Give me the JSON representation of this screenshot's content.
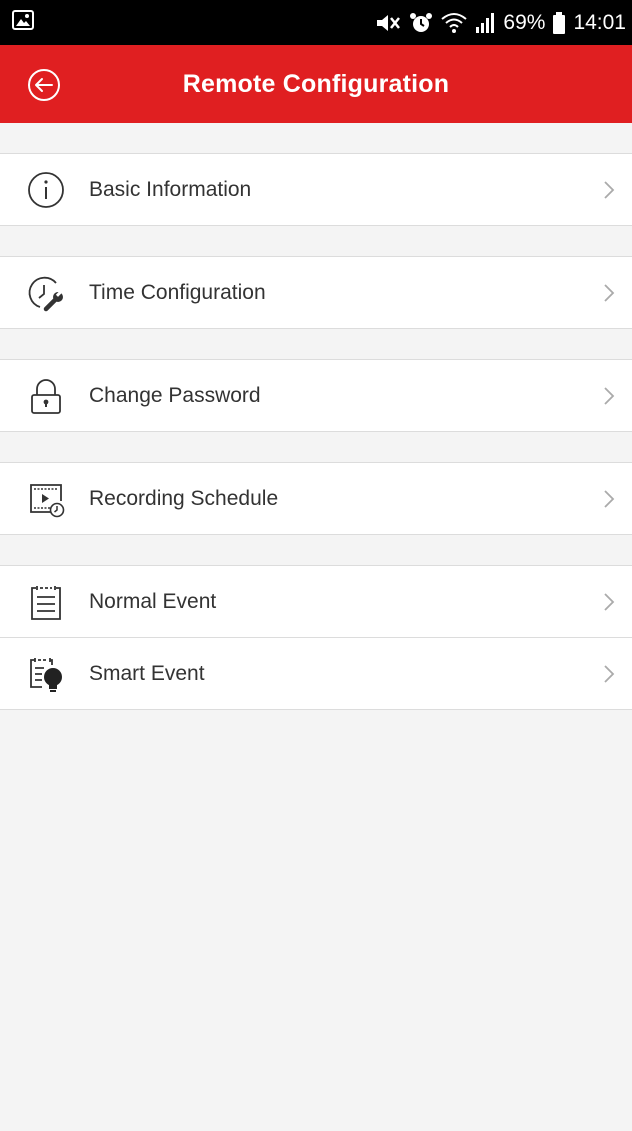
{
  "status_bar": {
    "battery": "69%",
    "time": "14:01"
  },
  "header": {
    "title": "Remote Configuration"
  },
  "menu": {
    "items": [
      {
        "label": "Basic Information",
        "icon": "info-icon"
      },
      {
        "label": "Time Configuration",
        "icon": "clock-wrench-icon"
      },
      {
        "label": "Change Password",
        "icon": "lock-icon"
      },
      {
        "label": "Recording Schedule",
        "icon": "recording-schedule-icon"
      },
      {
        "label": "Normal Event",
        "icon": "event-list-icon"
      },
      {
        "label": "Smart Event",
        "icon": "smart-event-icon"
      }
    ]
  },
  "colors": {
    "accent": "#e01f21",
    "background": "#f4f4f4"
  }
}
